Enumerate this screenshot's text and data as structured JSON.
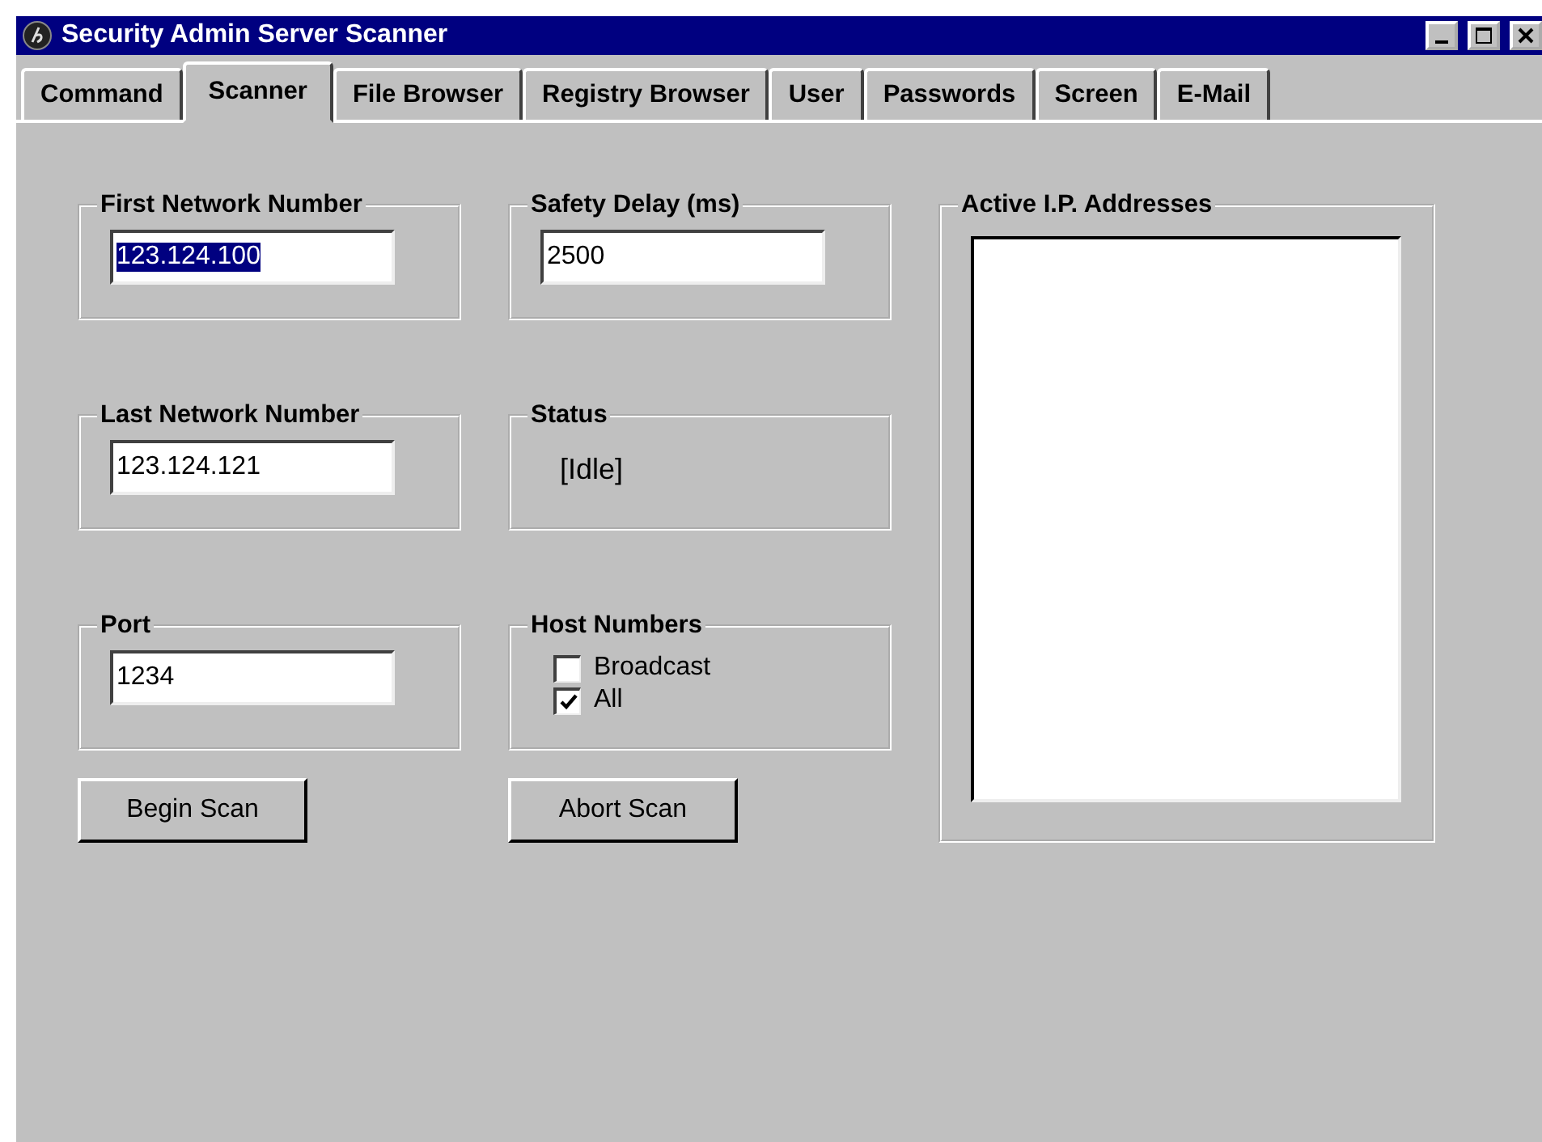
{
  "window": {
    "title": "Security Admin Server Scanner"
  },
  "tabs": [
    {
      "label": "Command",
      "selected": false
    },
    {
      "label": "Scanner",
      "selected": true
    },
    {
      "label": "File Browser",
      "selected": false
    },
    {
      "label": "Registry Browser",
      "selected": false
    },
    {
      "label": "User",
      "selected": false
    },
    {
      "label": "Passwords",
      "selected": false
    },
    {
      "label": "Screen",
      "selected": false
    },
    {
      "label": "E-Mail",
      "selected": false
    }
  ],
  "first_network_number": {
    "label": "First Network Number",
    "value": "123.124.100",
    "selected": true
  },
  "safety_delay": {
    "label": "Safety Delay (ms)",
    "value": "2500",
    "selected": false
  },
  "last_network_number": {
    "label": "Last Network Number",
    "value": "123.124.121",
    "selected": false
  },
  "status": {
    "label": "Status",
    "text": "[Idle]"
  },
  "port": {
    "label": "Port",
    "value": "1234",
    "selected": false
  },
  "host_numbers": {
    "label": "Host Numbers",
    "options": [
      {
        "label": "Broadcast",
        "checked": false
      },
      {
        "label": "All",
        "checked": true
      }
    ]
  },
  "buttons": [
    "Begin Scan",
    "Abort Scan"
  ],
  "active_ip_addresses": {
    "label": "Active I.P. Addresses"
  }
}
